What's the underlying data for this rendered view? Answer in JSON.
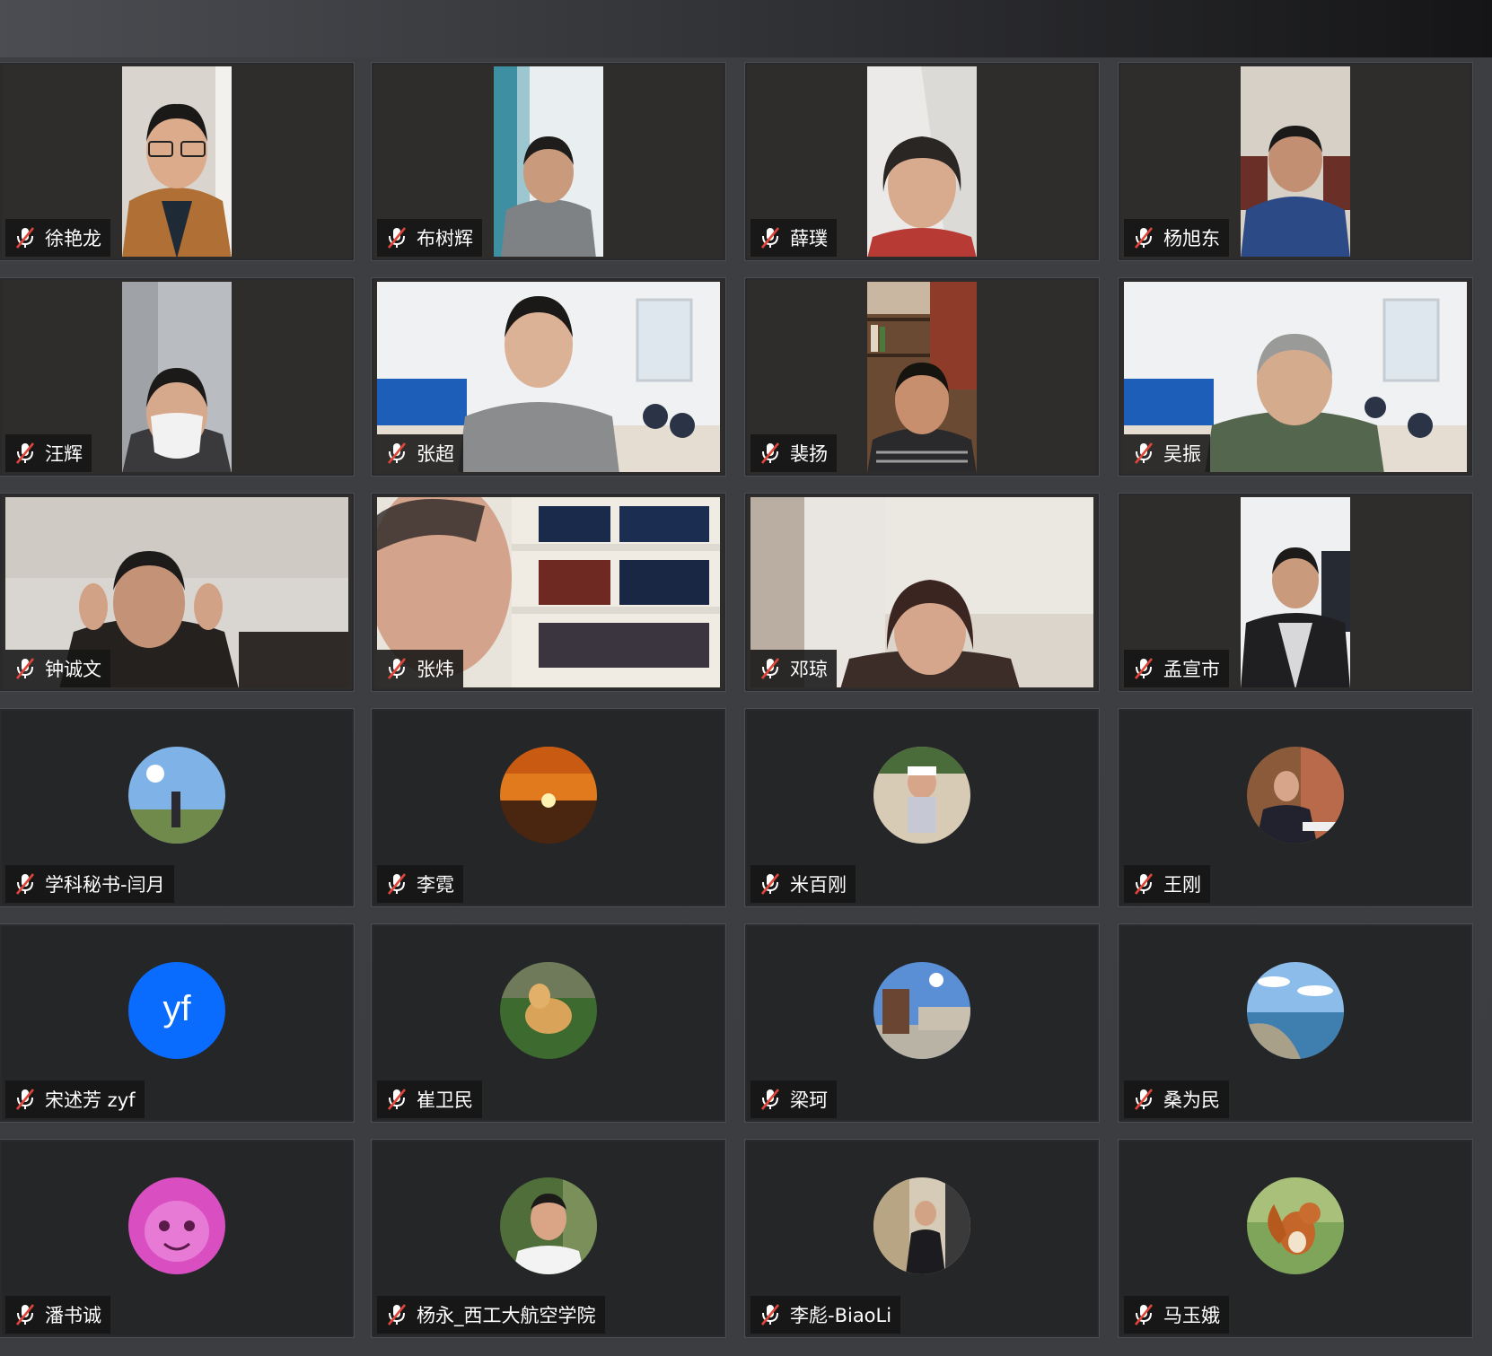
{
  "colors": {
    "background": "#3b3d41",
    "tile": "#252628",
    "avatar_initials": "#0a6cff",
    "muted_red": "#e0453a"
  },
  "participants": [
    {
      "name": "徐艳龙",
      "video": "narrow",
      "scene": "portrait-light"
    },
    {
      "name": "布树辉",
      "video": "narrow",
      "scene": "portrait-curtain"
    },
    {
      "name": "薛璞",
      "video": "narrow",
      "scene": "portrait-white"
    },
    {
      "name": "杨旭东",
      "video": "narrow",
      "scene": "portrait-office"
    },
    {
      "name": "汪辉",
      "video": "narrow",
      "scene": "portrait-car"
    },
    {
      "name": "张超",
      "video": "full",
      "scene": "room-blue-sofa"
    },
    {
      "name": "裴扬",
      "video": "narrow",
      "scene": "portrait-bookshelf"
    },
    {
      "name": "吴振",
      "video": "full",
      "scene": "room-blue-sofa"
    },
    {
      "name": "钟诚文",
      "video": "full",
      "scene": "room-ceiling"
    },
    {
      "name": "张炜",
      "video": "full",
      "scene": "bookshelf-blur"
    },
    {
      "name": "邓琼",
      "video": "full",
      "scene": "room-window"
    },
    {
      "name": "孟宣市",
      "video": "narrow",
      "scene": "portrait-board"
    },
    {
      "name": "学科秘书-闫月",
      "video": "none",
      "avatar": "sky-photo-icon"
    },
    {
      "name": "李霓",
      "video": "none",
      "avatar": "sunset-photo-icon"
    },
    {
      "name": "米百刚",
      "video": "none",
      "avatar": "child-photo-icon"
    },
    {
      "name": "王刚",
      "video": "none",
      "avatar": "man-photo-icon"
    },
    {
      "name": "宋述芳 zyf",
      "video": "none",
      "initials": "yf"
    },
    {
      "name": "崔卫民",
      "video": "none",
      "avatar": "dog-photo-icon"
    },
    {
      "name": "梁珂",
      "video": "none",
      "avatar": "building-photo-icon"
    },
    {
      "name": "桑为民",
      "video": "none",
      "avatar": "beach-photo-icon"
    },
    {
      "name": "潘书诚",
      "video": "none",
      "avatar": "cartoon-photo-icon"
    },
    {
      "name": "杨永_西工大航空学院",
      "video": "none",
      "avatar": "man-trees-photo-icon"
    },
    {
      "name": "李彪-BiaoLi",
      "video": "none",
      "avatar": "man-street-photo-icon"
    },
    {
      "name": "马玉娥",
      "video": "none",
      "avatar": "squirrel-photo-icon"
    }
  ]
}
